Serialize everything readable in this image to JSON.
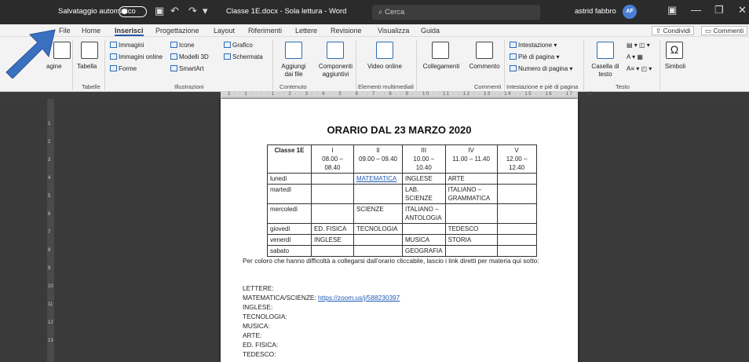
{
  "titlebar": {
    "autosave": "Salvataggio automatico",
    "doc": "Classe 1E.docx - Sola lettura - Word",
    "search": "Cerca",
    "user": "astrid fabbro",
    "initials": "AF"
  },
  "tabs": [
    "File",
    "Home",
    "Inserisci",
    "Progettazione",
    "Layout",
    "Riferimenti",
    "Lettere",
    "Revisione",
    "Visualizza",
    "Guida"
  ],
  "share": "Condividi",
  "comments": "Commenti",
  "ribbon": {
    "pagine": "agine",
    "tabella": "Tabella",
    "immagini": "Immagini",
    "immagini_online": "Immagini online",
    "forme": "Forme",
    "icone": "Icone",
    "modelli3d": "Modelli 3D",
    "smartart": "SmartArt",
    "grafico": "Grafico",
    "schermata": "Schermata",
    "aggiungi": "Aggiungi dai file",
    "componenti": "Componenti aggiuntivi",
    "video": "Video online",
    "collegamenti": "Collegamenti",
    "commento": "Commento",
    "intestazione": "Intestazione",
    "pie": "Piè di pagina",
    "numero": "Numero di pagina",
    "casella": "Casella di testo",
    "simboli": "Simboli",
    "groups": [
      "Tabelle",
      "Illustrazioni",
      "Contenuto",
      "Elementi multimediali",
      "Commenti",
      "Intestazione e piè di pagina",
      "Testo"
    ]
  },
  "ruler": "2 · · 1 · · · · 1 · · 2 · · 3 · · 4 · · 5 · · 6 · · 7 · · 8 · · 9 · · 10 · · 11 · · 12 · · 13 · · 14 · · 15 · · 16 · · 17 · · 18",
  "vruler": [
    "1",
    "2",
    "3",
    "4",
    "5",
    "6",
    "7",
    "8",
    "9",
    "10",
    "11",
    "12",
    "13"
  ],
  "document": {
    "title": "ORARIO DAL 23 MARZO 2020",
    "header": [
      "Classe 1E",
      "I\n08.00 –\n08.40",
      "II\n09.00 – 09.40",
      "III\n10.00 –\n10.40",
      "IV\n11.00 – 11.40",
      "V\n12.00 –\n12.40"
    ],
    "rows": [
      [
        "lunedì",
        "",
        "MATEMATICA",
        "INGLESE",
        "ARTE",
        ""
      ],
      [
        "martedì",
        "",
        "",
        "LAB.\nSCIENZE",
        "ITALIANO –\nGRAMMATICA",
        ""
      ],
      [
        "mercoledì",
        "",
        "SCIENZE",
        "ITALIANO –\nANTOLOGIA",
        "",
        ""
      ],
      [
        "giovedì",
        "ED. FISICA",
        "TECNOLOGIA",
        "",
        "TEDESCO",
        ""
      ],
      [
        "venerdì",
        "INGLESE",
        "",
        "MUSICA",
        "STORIA",
        ""
      ],
      [
        "sabato",
        "",
        "",
        "GEOGRAFIA",
        "",
        ""
      ]
    ],
    "intro": "Per coloro che hanno difficoltà a collegarsi dall’orario cliccabile, lascio i link diretti per materia qui sotto:",
    "lettere": "LETTERE:",
    "mat_label": "MATEMATICA/SCIENZE: ",
    "mat_link": "https://zoom.us/j/588230397",
    "links": [
      "INGLESE:",
      "TECNOLOGIA:",
      "MUSICA:",
      "ARTE:",
      "ED. FISICA:",
      "TEDESCO:"
    ]
  },
  "colors": {
    "accent": "#1e5aa8",
    "arrow": "#3b6fc0",
    "titlebar": "#2b2b2b"
  }
}
